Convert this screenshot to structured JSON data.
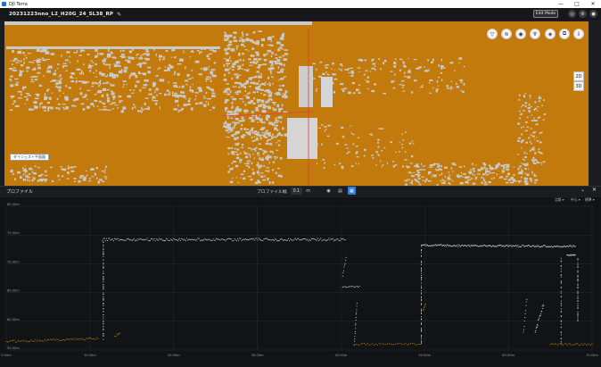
{
  "window": {
    "app_name": "DJI Terra",
    "minimize": "—",
    "maximize": "□",
    "close": "✕"
  },
  "header": {
    "project_name": "20231223nno_L2_H20G_24_SL38_RP",
    "edit_icon": "pencil-icon",
    "edit_mode_label": "Edit Mode"
  },
  "map": {
    "background_color": "#c27a0c",
    "label": "ダイジェスト平面図",
    "view_buttons": [
      "2D",
      "3D"
    ],
    "tools": [
      "filter-icon",
      "layers-icon",
      "locate-icon",
      "marker-icon",
      "measure-icon",
      "crop-icon",
      "export-icon"
    ]
  },
  "profile_panel": {
    "title": "プロファイル",
    "width_label": "プロファイル幅",
    "width_value": "0.1",
    "unit": "m",
    "options": [
      "点群 ▾",
      "中心 ▾",
      "標準 ▾"
    ]
  },
  "chart_data": {
    "type": "scatter",
    "y_ticks": [
      "55.00m",
      "60.00m",
      "65.00m",
      "70.00m",
      "75.00m",
      "80.00m"
    ],
    "x_ticks": [
      "0.00m",
      "10.00m",
      "20.00m",
      "30.00m",
      "40.00m",
      "50.00m",
      "60.00m",
      "70.00m"
    ],
    "ylim": [
      55,
      80
    ],
    "xlim": [
      0,
      70
    ],
    "grid": true
  }
}
